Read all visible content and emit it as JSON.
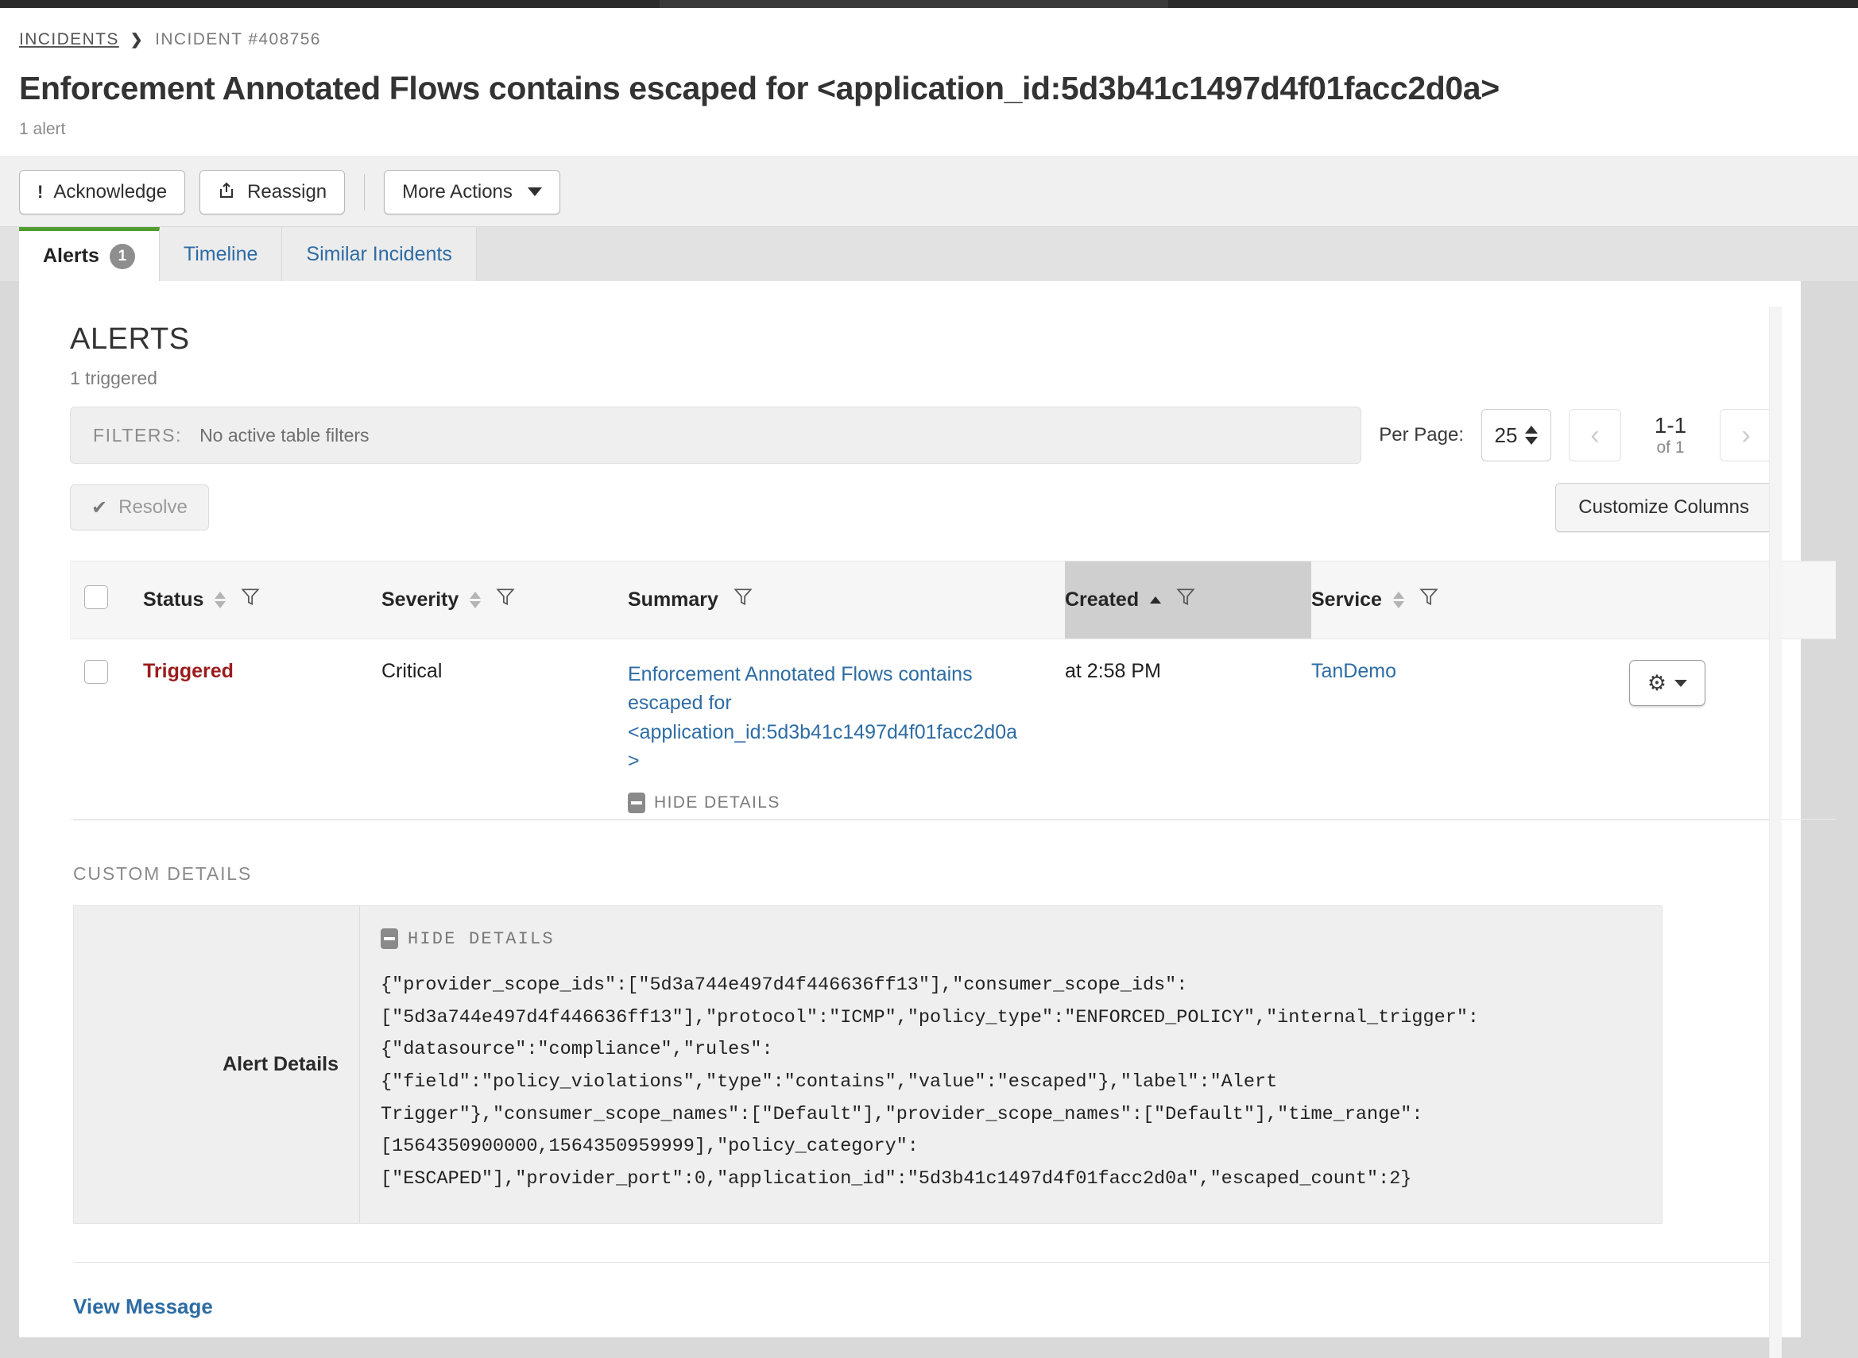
{
  "breadcrumb": {
    "root": "INCIDENTS",
    "separator": "❯",
    "current": "INCIDENT #408756"
  },
  "header": {
    "title": "Enforcement Annotated Flows contains escaped for <application_id:5d3b41c1497d4f01facc2d0a>",
    "subtitle": "1 alert"
  },
  "toolbar": {
    "acknowledge_label": "Acknowledge",
    "acknowledge_icon": "exclamation-icon",
    "reassign_label": "Reassign",
    "reassign_icon": "share-arrow-icon",
    "more_actions_label": "More Actions",
    "more_actions_icon": "chevron-down-icon"
  },
  "tabs": [
    {
      "label": "Alerts",
      "badge": "1",
      "active": true
    },
    {
      "label": "Timeline",
      "badge": "",
      "active": false
    },
    {
      "label": "Similar Incidents",
      "badge": "",
      "active": false
    }
  ],
  "alerts_section": {
    "title": "ALERTS",
    "subtitle": "1 triggered",
    "filters_label": "FILTERS:",
    "filters_value": "No active table filters",
    "per_page_label": "Per Page:",
    "per_page_value": "25",
    "prev_icon": "chevron-left-icon",
    "next_icon": "chevron-right-icon",
    "page_range": "1-1",
    "page_of": "of 1",
    "resolve_label": "Resolve",
    "resolve_icon": "check-icon",
    "customize_columns_label": "Customize Columns"
  },
  "table": {
    "columns": [
      {
        "label": "Status",
        "sortable": true,
        "filter": true,
        "sorted": false
      },
      {
        "label": "Severity",
        "sortable": true,
        "filter": true,
        "sorted": false
      },
      {
        "label": "Summary",
        "sortable": false,
        "filter": true,
        "sorted": false
      },
      {
        "label": "Created",
        "sortable": true,
        "filter": true,
        "sorted": true,
        "sort_dir": "asc"
      },
      {
        "label": "Service",
        "sortable": true,
        "filter": true,
        "sorted": false
      }
    ],
    "rows": [
      {
        "status": "Triggered",
        "severity": "Critical",
        "summary": "Enforcement Annotated Flows contains escaped for <application_id:5d3b41c1497d4f01facc2d0a>",
        "hide_details_label": "HIDE DETAILS",
        "created": "at 2:58 PM",
        "service": "TanDemo",
        "row_menu_icon": "gear-icon"
      }
    ]
  },
  "custom_details": {
    "title": "CUSTOM DETAILS",
    "hide_details_label": "HIDE DETAILS",
    "label": "Alert Details",
    "json": "{\"provider_scope_ids\":[\"5d3a744e497d4f446636ff13\"],\"consumer_scope_ids\":[\"5d3a744e497d4f446636ff13\"],\"protocol\":\"ICMP\",\"policy_type\":\"ENFORCED_POLICY\",\"internal_trigger\":{\"datasource\":\"compliance\",\"rules\":{\"field\":\"policy_violations\",\"type\":\"contains\",\"value\":\"escaped\"},\"label\":\"Alert Trigger\"},\"consumer_scope_names\":[\"Default\"],\"provider_scope_names\":[\"Default\"],\"time_range\":[1564350900000,1564350959999],\"policy_category\":[\"ESCAPED\"],\"provider_port\":0,\"application_id\":\"5d3b41c1497d4f01facc2d0a\",\"escaped_count\":2}",
    "view_message_label": "View Message"
  },
  "colors": {
    "accent_green": "#4f9c2f",
    "link_blue": "#2e6ca4",
    "status_red": "#9b1c1c"
  }
}
